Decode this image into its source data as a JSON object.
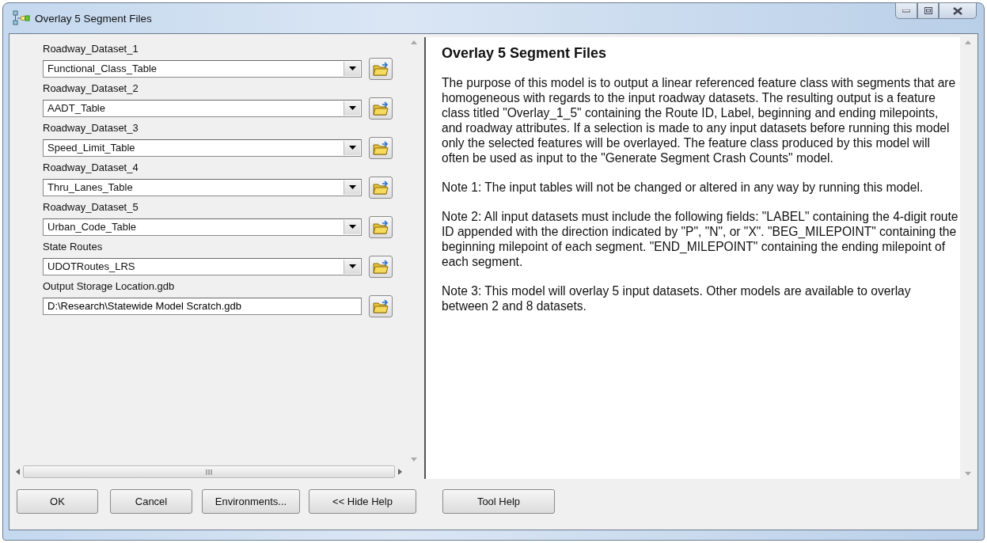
{
  "window": {
    "title": "Overlay 5 Segment Files"
  },
  "parameters": [
    {
      "label": "Roadway_Dataset_1",
      "value": "Functional_Class_Table",
      "kind": "dropdown"
    },
    {
      "label": "Roadway_Dataset_2",
      "value": "AADT_Table",
      "kind": "dropdown"
    },
    {
      "label": "Roadway_Dataset_3",
      "value": "Speed_Limit_Table",
      "kind": "dropdown"
    },
    {
      "label": "Roadway_Dataset_4",
      "value": "Thru_Lanes_Table",
      "kind": "dropdown"
    },
    {
      "label": "Roadway_Dataset_5",
      "value": "Urban_Code_Table",
      "kind": "dropdown"
    },
    {
      "label": "State Routes",
      "value": "UDOTRoutes_LRS",
      "kind": "dropdown"
    },
    {
      "label": "Output Storage Location.gdb",
      "value": "D:\\Research\\Statewide Model Scratch.gdb",
      "kind": "text"
    }
  ],
  "help": {
    "title": "Overlay 5 Segment Files",
    "paragraphs": [
      "The purpose of this model is to output a linear referenced feature class with segments that are homogeneous with regards to the input roadway datasets. The resulting output is a feature class titled \"Overlay_1_5\" containing the Route ID, Label, beginning and ending milepoints, and roadway attributes. If a selection is made to any input datasets before running this model only the selected features will be overlayed. The feature class produced by this model will often be used as input to the \"Generate Segment Crash Counts\" model.",
      "Note 1: The input tables will not be changed or altered in any way by running this model.",
      "Note 2: All input datasets must include the following fields: \"LABEL\" containing the 4-digit route ID appended with the direction indicated by \"P\", \"N\", or \"X\". \"BEG_MILEPOINT\" containing the beginning milepoint of each segment. \"END_MILEPOINT\" containing the ending milepoint of each segment.",
      "Note 3: This model will overlay 5 input datasets. Other models are available to overlay between 2 and 8 datasets."
    ]
  },
  "buttons": [
    "OK",
    "Cancel",
    "Environments...",
    "<< Hide Help"
  ],
  "help_button": "Tool Help"
}
